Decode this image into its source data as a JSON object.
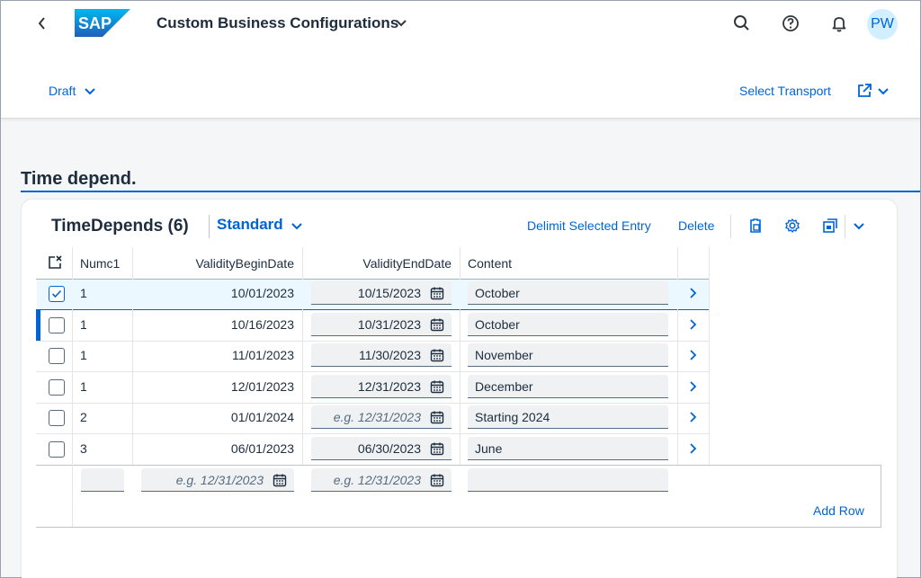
{
  "shell": {
    "app_title": "Custom Business Configurations",
    "avatar_initials": "PW",
    "logo_text": "SAP",
    "icons": [
      "back-icon",
      "search-icon",
      "help-icon",
      "notification-icon"
    ]
  },
  "header": {
    "status": "Draft",
    "select_transport": "Select Transport"
  },
  "section": {
    "title": "Time depend."
  },
  "table": {
    "title": "TimeDepends (6)",
    "variant": "Standard",
    "actions": {
      "delimit": "Delimit Selected Entry",
      "delete": "Delete"
    },
    "columns": [
      "Numc1",
      "ValidityBeginDate",
      "ValidityEndDate",
      "Content"
    ],
    "rows": [
      {
        "numc1": "1",
        "begin": "10/01/2023",
        "end": "10/15/2023",
        "content": "October",
        "selected": true
      },
      {
        "numc1": "1",
        "begin": "10/16/2023",
        "end": "10/31/2023",
        "content": "October",
        "selected": false
      },
      {
        "numc1": "1",
        "begin": "11/01/2023",
        "end": "11/30/2023",
        "content": "November",
        "selected": false
      },
      {
        "numc1": "1",
        "begin": "12/01/2023",
        "end": "12/31/2023",
        "content": "December",
        "selected": false
      },
      {
        "numc1": "2",
        "begin": "01/01/2024",
        "end": "",
        "content": "Starting 2024",
        "selected": false
      },
      {
        "numc1": "3",
        "begin": "06/01/2023",
        "end": "06/30/2023",
        "content": "June",
        "selected": false
      }
    ],
    "date_placeholder": "e.g. 12/31/2023",
    "add_row": "Add Row"
  },
  "colors": {
    "accent": "#0064d9",
    "text": "#1d2d3e",
    "field_bg": "#eff1f2",
    "selected_row": "#ebf8ff"
  }
}
